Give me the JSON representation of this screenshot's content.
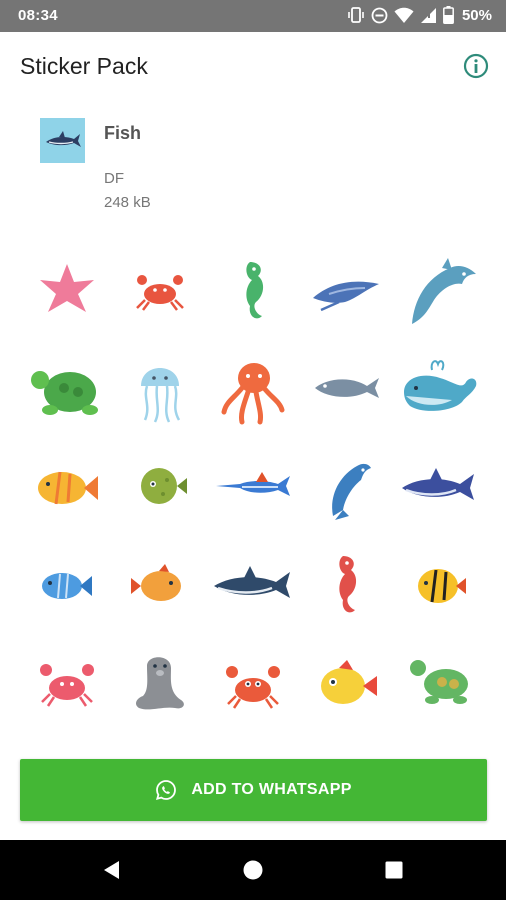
{
  "status_bar": {
    "time": "08:34",
    "battery": "50%",
    "icons": [
      "vibrate-icon",
      "do-not-disturb-icon",
      "wifi-icon",
      "cell-signal-icon",
      "battery-icon"
    ]
  },
  "app_bar": {
    "title": "Sticker Pack",
    "info_icon": "info-icon"
  },
  "pack": {
    "name": "Fish",
    "author": "DF",
    "size": "248 kB",
    "tray_icon": "shark-icon"
  },
  "stickers": [
    {
      "name": "starfish",
      "color": "#ef7b9a"
    },
    {
      "name": "crab",
      "color": "#e8553f"
    },
    {
      "name": "seahorse",
      "color": "#49b36b"
    },
    {
      "name": "manta-ray",
      "color": "#4c73b7"
    },
    {
      "name": "dolphin",
      "color": "#5b9fbf"
    },
    {
      "name": "turtle",
      "color": "#4ba84a"
    },
    {
      "name": "jellyfish",
      "color": "#9fd3ea"
    },
    {
      "name": "octopus",
      "color": "#ef6a3f"
    },
    {
      "name": "grey-fish",
      "color": "#7b8fa3"
    },
    {
      "name": "whale",
      "color": "#4fa9c8"
    },
    {
      "name": "yellow-fish",
      "color": "#f6b533"
    },
    {
      "name": "pufferfish",
      "color": "#8fae3f"
    },
    {
      "name": "swordfish",
      "color": "#3a7ad3"
    },
    {
      "name": "blue-dolphin",
      "color": "#3c7fc0"
    },
    {
      "name": "shark",
      "color": "#3c4f9e"
    },
    {
      "name": "blue-fish",
      "color": "#4d9be0"
    },
    {
      "name": "orange-fish",
      "color": "#f2a03c"
    },
    {
      "name": "dark-shark",
      "color": "#2f4a6a"
    },
    {
      "name": "red-seahorse",
      "color": "#e1504a"
    },
    {
      "name": "striped-fish",
      "color": "#f6c028"
    },
    {
      "name": "pink-crab",
      "color": "#ec5b6d"
    },
    {
      "name": "seal",
      "color": "#8c8f94"
    },
    {
      "name": "red-crab",
      "color": "#ea5a3b"
    },
    {
      "name": "round-yellow-fish",
      "color": "#f6d03a"
    },
    {
      "name": "green-turtle",
      "color": "#63b663"
    }
  ],
  "add_button": {
    "label": "ADD TO WHATSAPP",
    "icon": "whatsapp-icon",
    "color": "#44b735"
  },
  "nav_bar": {
    "icons": [
      "back-icon",
      "home-icon",
      "recents-icon"
    ]
  }
}
